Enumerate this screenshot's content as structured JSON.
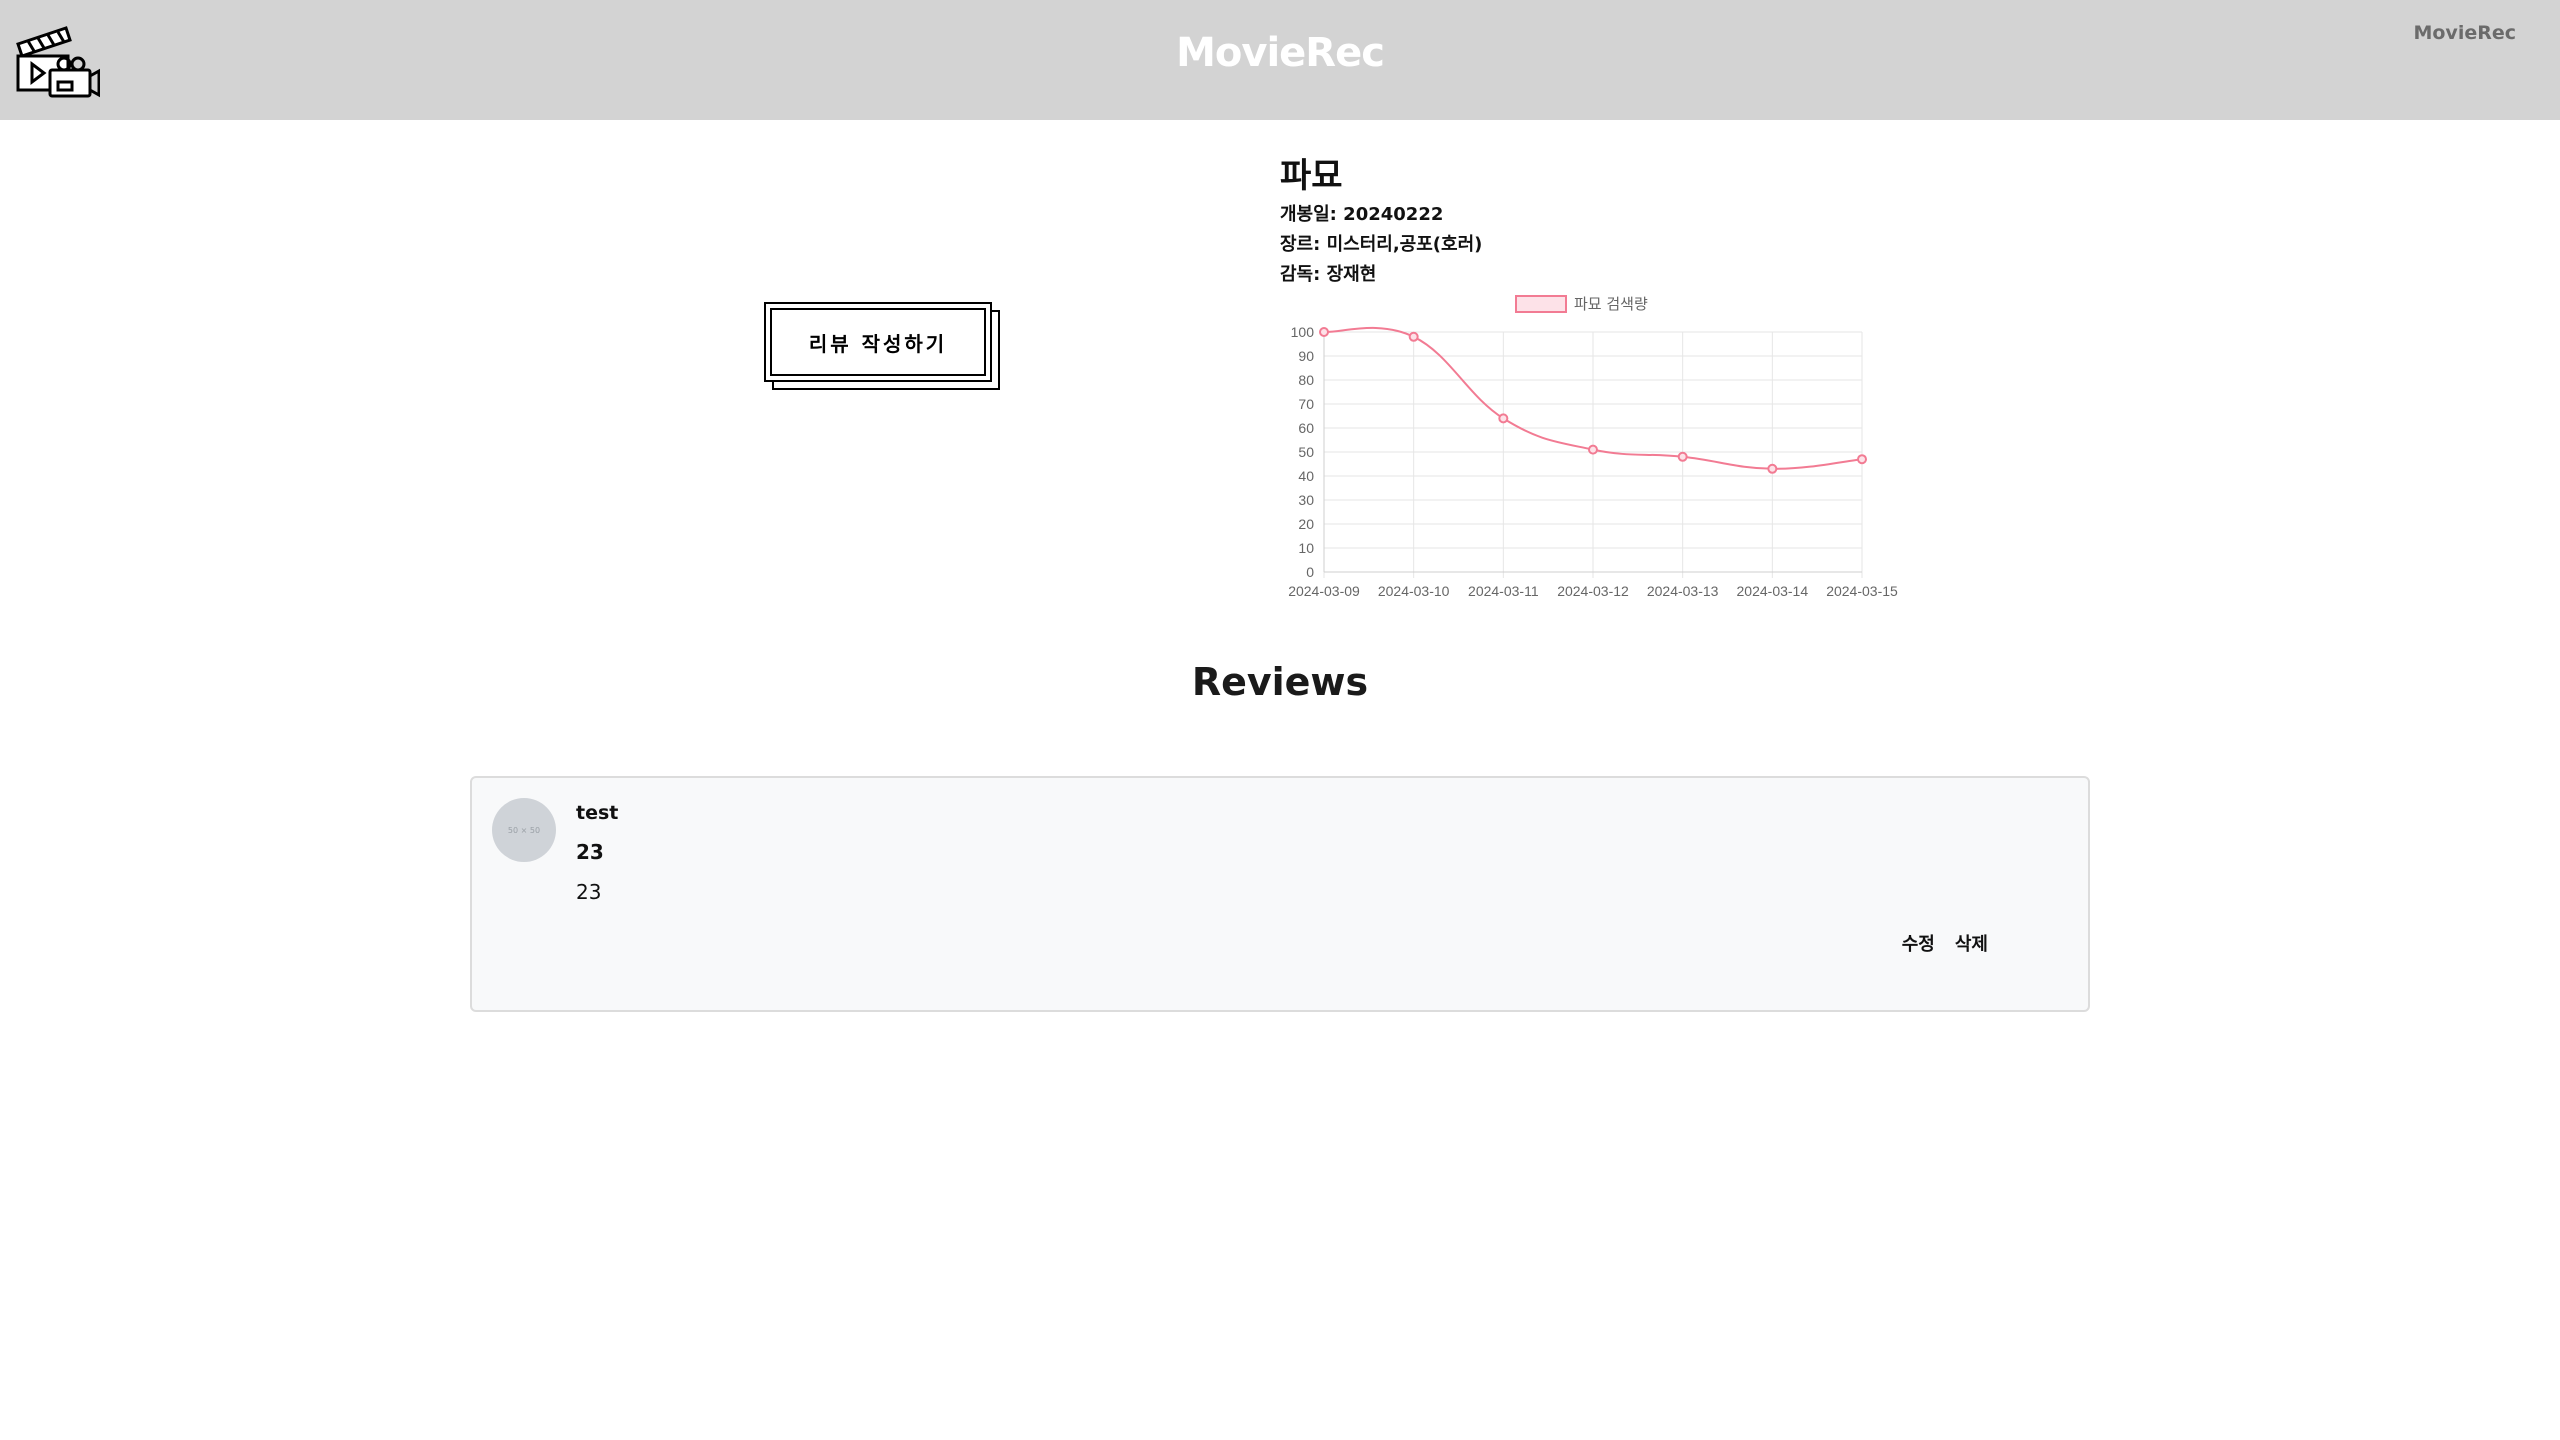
{
  "header": {
    "brand": "MovieRec",
    "nav_link": "MovieRec",
    "logo_icon": "clapperboard-camera-icon",
    "background": "#d3d3d3"
  },
  "actions": {
    "write_review_label": "리뷰 작성하기"
  },
  "movie": {
    "title": "파묘",
    "release_label": "개봉일:",
    "release_value": "20240222",
    "genre_label": "장르:",
    "genre_value": "미스터리,공포(호러)",
    "director_label": "감독:",
    "director_value": "장재현"
  },
  "chart_data": {
    "type": "line",
    "x": [
      "2024-03-09",
      "2024-03-10",
      "2024-03-11",
      "2024-03-12",
      "2024-03-13",
      "2024-03-14",
      "2024-03-15"
    ],
    "series": [
      {
        "name": "파묘 검색량",
        "values": [
          100,
          98,
          64,
          51,
          48,
          43,
          47
        ],
        "color": "#f27b93"
      }
    ],
    "ylim": [
      0,
      100
    ],
    "yticks": [
      0,
      10,
      20,
      30,
      40,
      50,
      60,
      70,
      80,
      90,
      100
    ],
    "grid": true,
    "legend": "top"
  },
  "reviews": {
    "title": "Reviews",
    "items": [
      {
        "avatar_text": "50 × 50",
        "user": "test",
        "rating": "23",
        "content": "23",
        "edit_label": "수정",
        "delete_label": "삭제"
      }
    ]
  }
}
